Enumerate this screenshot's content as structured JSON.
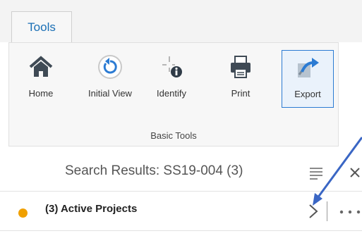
{
  "tabs": [
    {
      "label": "Tools",
      "active": true
    }
  ],
  "ribbon": {
    "group_label": "Basic Tools",
    "tools": [
      {
        "label": "Home",
        "icon": "home-icon"
      },
      {
        "label": "Initial View",
        "icon": "initial-view-icon"
      },
      {
        "label": "Identify",
        "icon": "identify-icon"
      },
      {
        "label": "Print",
        "icon": "print-icon"
      },
      {
        "label": "Export",
        "icon": "export-icon",
        "selected": true
      }
    ]
  },
  "results": {
    "title": "Search Results: SS19-004 (3)",
    "rows": [
      {
        "label": "(3) Active Projects",
        "dot_color": "#f0a000"
      }
    ]
  },
  "colors": {
    "accent": "#2b7bd3",
    "tab_text": "#1a6fb5",
    "icon_dark": "#3f4a55",
    "annotation_arrow": "#3a66c4"
  }
}
